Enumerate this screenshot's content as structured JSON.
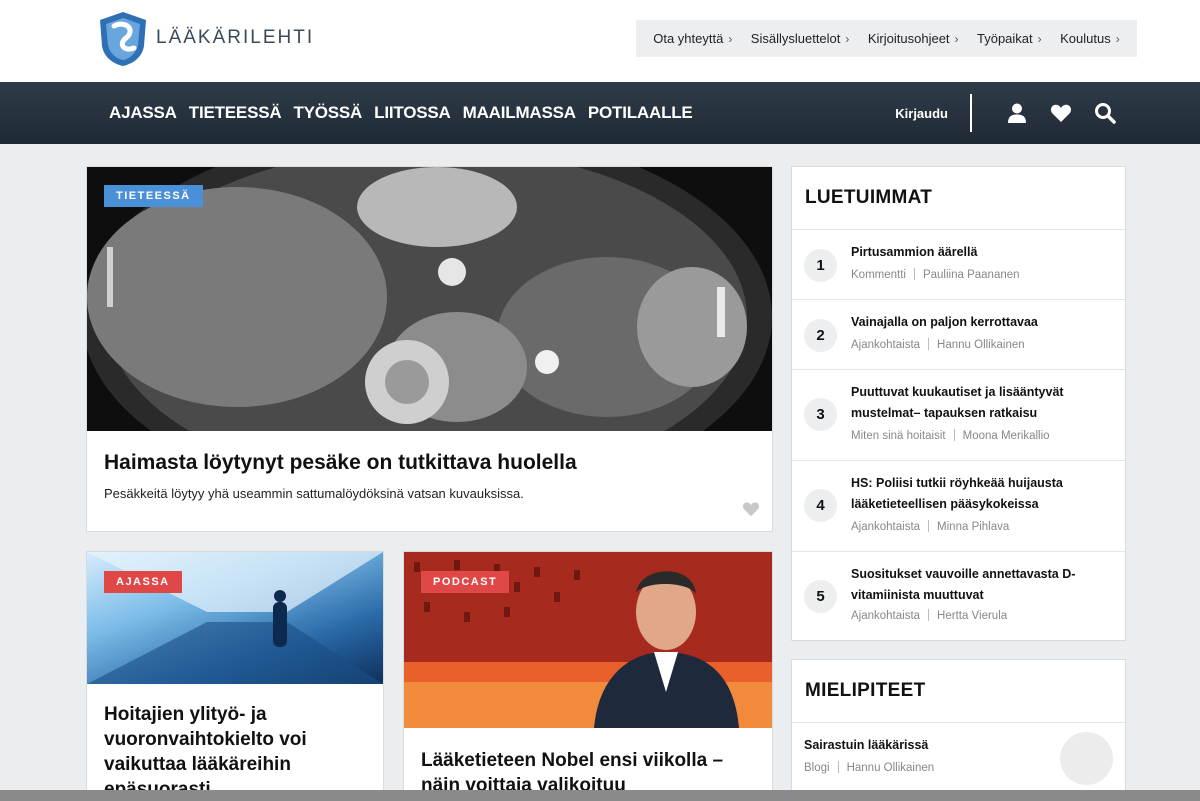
{
  "brand": {
    "name": "LÄÄKÄRILEHTI"
  },
  "utility_nav": [
    {
      "label": "Ota yhteyttä"
    },
    {
      "label": "Sisällysluettelot"
    },
    {
      "label": "Kirjoitusohjeet"
    },
    {
      "label": "Työpaikat"
    },
    {
      "label": "Koulutus"
    }
  ],
  "main_nav": [
    "AJASSA",
    "TIETEESSÄ",
    "TYÖSSÄ",
    "LIITOSSA",
    "MAAILMASSA",
    "POTILAALLE"
  ],
  "nav_right": {
    "login": "Kirjaudu"
  },
  "hero": {
    "badge": "TIETEESSÄ",
    "title": "Haimasta löytynyt pesäke on tutkittava huolella",
    "subtitle": "Pesäkkeitä löytyy yhä useammin sattumalöydöksinä vatsan kuvauksissa."
  },
  "cards": [
    {
      "badge": "AJASSA",
      "title": "Hoitajien ylityö- ja vuoronvaihtokielto voi vaikuttaa lääkäreihin epäsuorasti"
    },
    {
      "badge": "PODCAST",
      "title": "Lääketieteen Nobel ensi viikolla – näin voittaja valikoituu"
    }
  ],
  "most_read": {
    "heading": "LUETUIMMAT",
    "items": [
      {
        "rank": "1",
        "title": "Pirtusammion äärellä",
        "category": "Kommentti",
        "author": "Pauliina Paananen"
      },
      {
        "rank": "2",
        "title": "Vainajalla on paljon kerrottavaa",
        "category": "Ajankohtaista",
        "author": "Hannu Ollikainen"
      },
      {
        "rank": "3",
        "title": "Puuttuvat kuukautiset ja lisääntyvät mustelmat– tapauksen ratkaisu",
        "category": "Miten sinä hoitaisit",
        "author": "Moona Merikallio"
      },
      {
        "rank": "4",
        "title": "HS: Poliisi tutkii röyhkeää huijausta lääketieteellisen pääsykokeissa",
        "category": "Ajankohtaista",
        "author": "Minna Pihlava"
      },
      {
        "rank": "5",
        "title": "Suositukset vauvoille annettavasta D-vitamiinista muuttuvat",
        "category": "Ajankohtaista",
        "author": "Hertta Vierula"
      }
    ]
  },
  "opinions": {
    "heading": "MIELIPITEET",
    "items": [
      {
        "title": "Sairastuin lääkärissä",
        "category": "Blogi",
        "author": "Hannu Ollikainen"
      }
    ]
  },
  "colors": {
    "nav_bg": "#27323e",
    "badge_blue": "#4a90d6",
    "badge_red": "#e04848"
  }
}
